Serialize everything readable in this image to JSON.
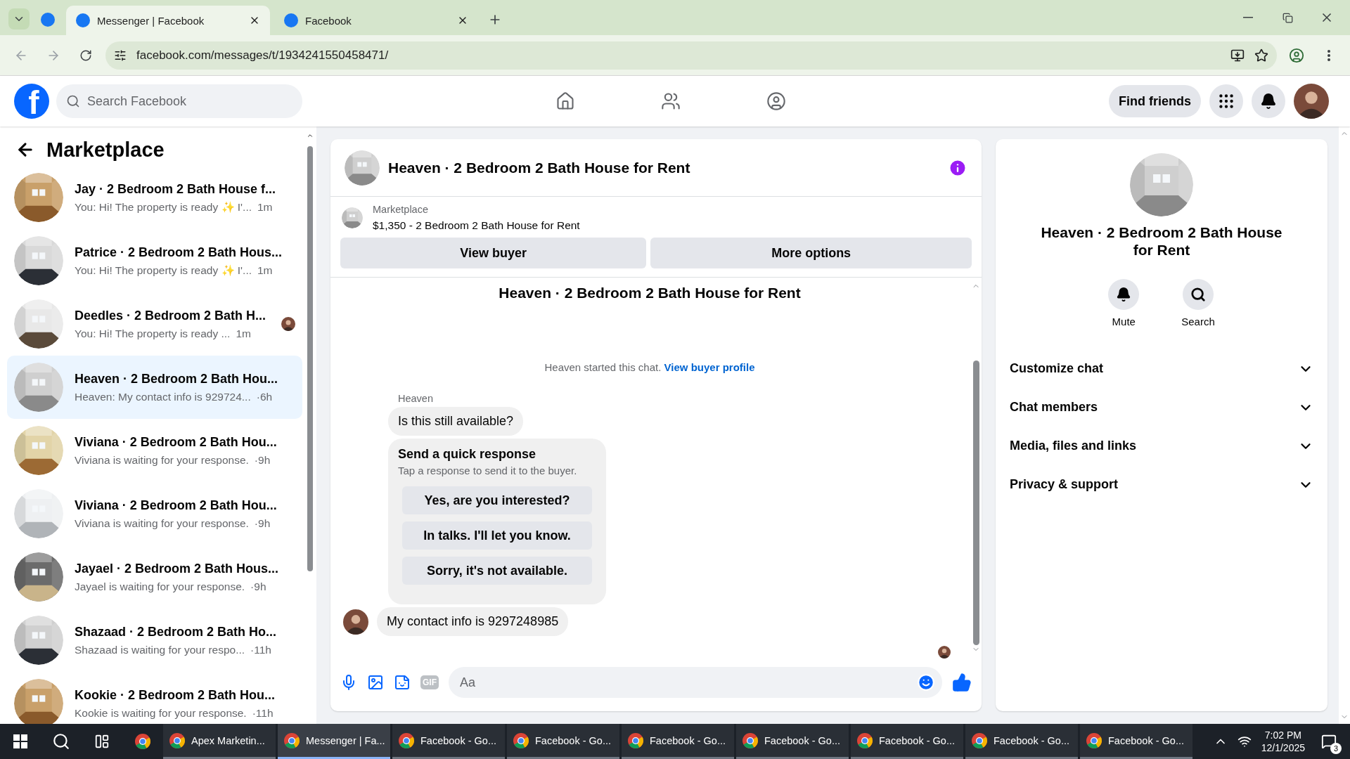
{
  "browser": {
    "tabs": [
      {
        "title": "Messenger | Facebook",
        "selected": true
      },
      {
        "title": "Facebook",
        "selected": false
      }
    ],
    "url": "facebook.com/messages/t/1934241550458471/"
  },
  "header": {
    "logo": "f",
    "search_placeholder": "Search Facebook",
    "find_friends": "Find friends"
  },
  "sidebar": {
    "title": "Marketplace",
    "conversations": [
      {
        "name": "Jay · 2 Bedroom 2 Bath House f...",
        "preview": "You: Hi! The property is ready ✨ I'...",
        "time": "1m",
        "selected": false,
        "seen": false
      },
      {
        "name": "Patrice · 2 Bedroom 2 Bath Hous...",
        "preview": "You: Hi! The property is ready ✨ I'...",
        "time": "1m",
        "selected": false,
        "seen": false
      },
      {
        "name": "Deedles · 2 Bedroom 2 Bath H...",
        "preview": "You: Hi! The property is ready ...",
        "time": "1m",
        "selected": false,
        "seen": true
      },
      {
        "name": "Heaven · 2 Bedroom 2 Bath Hou...",
        "preview": "Heaven: My contact info is 929724...",
        "time": "·6h",
        "selected": true,
        "seen": false
      },
      {
        "name": "Viviana · 2 Bedroom 2 Bath Hou...",
        "preview": "Viviana is waiting for your response.",
        "time": "·9h",
        "selected": false,
        "seen": false
      },
      {
        "name": "Viviana · 2 Bedroom 2 Bath Hou...",
        "preview": "Viviana is waiting for your response.",
        "time": "·9h",
        "selected": false,
        "seen": false
      },
      {
        "name": "Jayael · 2 Bedroom 2 Bath Hous...",
        "preview": "Jayael is waiting for your response.",
        "time": "·9h",
        "selected": false,
        "seen": false
      },
      {
        "name": "Shazaad · 2 Bedroom 2 Bath Ho...",
        "preview": "Shazaad is waiting for your respo...",
        "time": "·11h",
        "selected": false,
        "seen": false
      },
      {
        "name": "Kookie · 2 Bedroom 2 Bath Hou...",
        "preview": "Kookie is waiting for your response.",
        "time": "·11h",
        "selected": false,
        "seen": false
      }
    ]
  },
  "chat": {
    "title": "Heaven · 2 Bedroom 2 Bath House for Rent",
    "listing_label": "Marketplace",
    "listing_detail": "$1,350 - 2 Bedroom 2 Bath House for Rent",
    "buttons": [
      "View buyer",
      "More options"
    ],
    "thread_title": "Heaven · 2 Bedroom 2 Bath House for Rent",
    "notice": "Heaven started this chat.",
    "notice_link": "View buyer profile",
    "sender": "Heaven",
    "first_message": "Is this still available?",
    "quick_response": {
      "title": "Send a quick response",
      "subtitle": "Tap a response to send it to the buyer.",
      "options": [
        "Yes, are you interested?",
        "In talks. I'll let you know.",
        "Sorry, it's not available."
      ]
    },
    "last_message": "My contact info is 9297248985",
    "gif_label": "GIF",
    "composer_placeholder": "Aa"
  },
  "details": {
    "title": "Heaven · 2 Bedroom 2 Bath House for Rent",
    "actions": [
      {
        "kind": "mute",
        "label": "Mute"
      },
      {
        "kind": "search",
        "label": "Search"
      }
    ],
    "sections": [
      "Customize chat",
      "Chat members",
      "Media, files and links",
      "Privacy & support"
    ]
  },
  "taskbar": {
    "apps": [
      {
        "label": "Apex Marketin...",
        "selected": false
      },
      {
        "label": "Messenger | Fa...",
        "selected": true
      },
      {
        "label": "Facebook - Go...",
        "selected": false
      },
      {
        "label": "Facebook - Go...",
        "selected": false
      },
      {
        "label": "Facebook - Go...",
        "selected": false
      },
      {
        "label": "Facebook - Go...",
        "selected": false
      },
      {
        "label": "Facebook - Go...",
        "selected": false
      },
      {
        "label": "Facebook - Go...",
        "selected": false
      },
      {
        "label": "Facebook - Go...",
        "selected": false
      }
    ],
    "time": "7:02 PM",
    "date": "12/1/2025",
    "notifications": "3"
  }
}
